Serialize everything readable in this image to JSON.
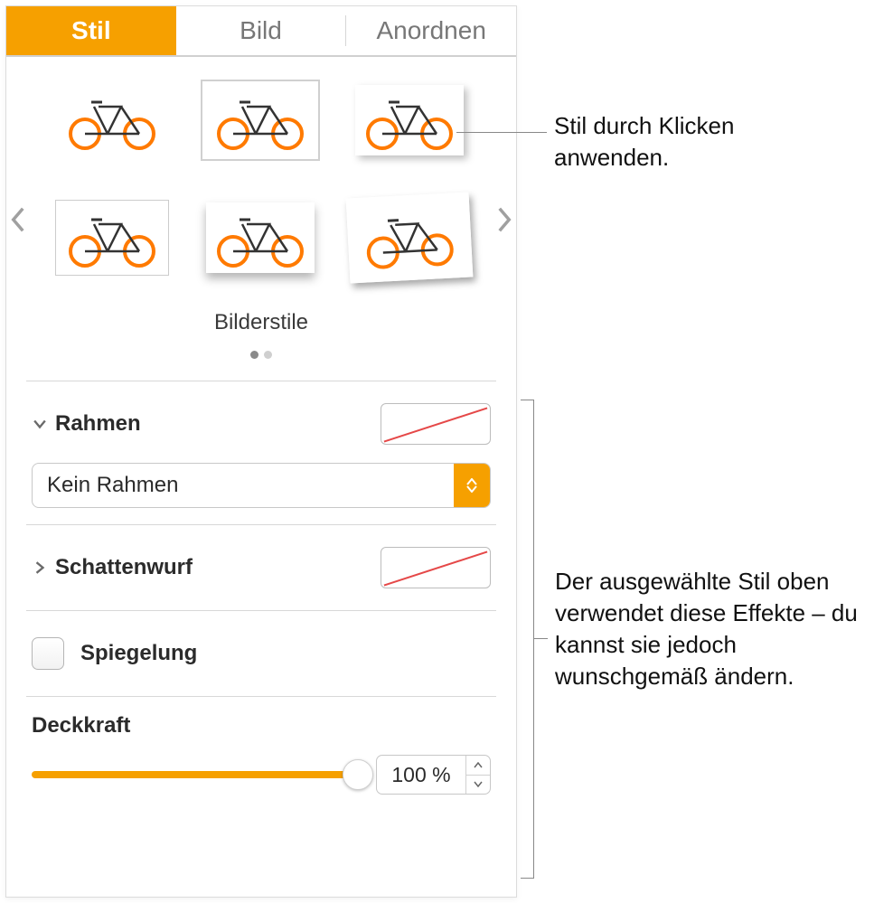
{
  "tabs": {
    "stil": "Stil",
    "bild": "Bild",
    "anordnen": "Anordnen"
  },
  "styles_title": "Bilderstile",
  "rahmen": {
    "label": "Rahmen",
    "select": "Kein Rahmen"
  },
  "schatten": {
    "label": "Schattenwurf"
  },
  "spiegelung": {
    "label": "Spiegelung"
  },
  "deckkraft": {
    "label": "Deckkraft",
    "value": "100 %"
  },
  "callouts": {
    "c1": "Stil durch Klicken anwenden.",
    "c2": "Der ausgewählte Stil oben verwendet diese Effekte – du kannst sie jedoch wunschgemäß ändern."
  },
  "colors": {
    "accent": "#f6a000"
  }
}
